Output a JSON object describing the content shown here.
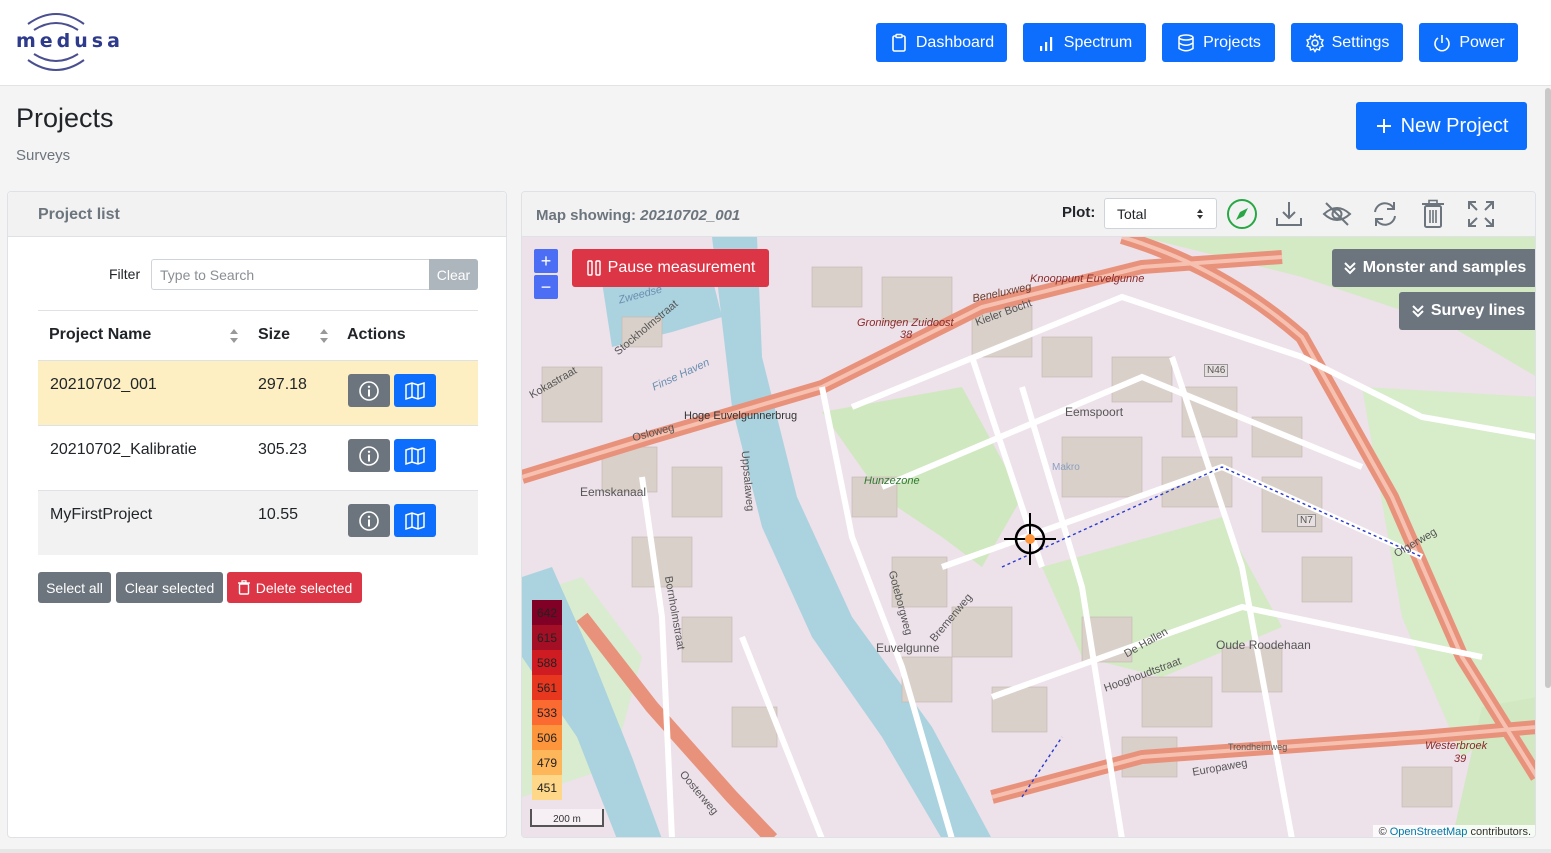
{
  "app": {
    "logo_text": "medusa"
  },
  "nav": {
    "dashboard": "Dashboard",
    "spectrum": "Spectrum",
    "projects": "Projects",
    "settings": "Settings",
    "power": "Power"
  },
  "page": {
    "title": "Projects",
    "subtitle": "Surveys",
    "new_project": "New Project"
  },
  "project_list": {
    "title": "Project list",
    "filter_label": "Filter",
    "filter_placeholder": "Type to Search",
    "filter_clear": "Clear",
    "columns": {
      "name": "Project Name",
      "size": "Size",
      "actions": "Actions"
    },
    "rows": [
      {
        "name": "20210702_001",
        "size": "297.18",
        "selected": true
      },
      {
        "name": "20210702_Kalibratie",
        "size": "305.23",
        "selected": false
      },
      {
        "name": "MyFirstProject",
        "size": "10.55",
        "selected": false
      }
    ],
    "select_all": "Select all",
    "clear_selected": "Clear selected",
    "delete_selected": "Delete selected"
  },
  "map": {
    "showing_label": "Map showing:",
    "showing_value": "20210702_001",
    "plot_label": "Plot:",
    "plot_value": "Total",
    "pause": "Pause measurement",
    "monster": "Monster and samples",
    "survey_lines": "Survey lines",
    "zoom_in": "+",
    "zoom_out": "−",
    "scale": "200 m",
    "attribution_prefix": "©",
    "attribution_link": "OpenStreetMap",
    "attribution_suffix": "contributors.",
    "legend": [
      {
        "value": "642",
        "color": "#800026"
      },
      {
        "value": "615",
        "color": "#a50f26"
      },
      {
        "value": "588",
        "color": "#cf1c23"
      },
      {
        "value": "561",
        "color": "#e7371f"
      },
      {
        "value": "533",
        "color": "#fa6a31"
      },
      {
        "value": "506",
        "color": "#fd953c"
      },
      {
        "value": "479",
        "color": "#feb65a"
      },
      {
        "value": "451",
        "color": "#fed888"
      }
    ],
    "labels": [
      "Beneluxweg",
      "Knooppunt Euvelgunne",
      "Groningen Zuidoost",
      "38",
      "Kieler Bocht",
      "N46",
      "Eemspoort",
      "Hoge Euvelgunnerbrug",
      "Osloweg",
      "Eemskanaal",
      "Hunzezone",
      "Euvelgunne",
      "Oude Roodehaan",
      "Oosterweg",
      "Europaweg",
      "Westerbroek",
      "39",
      "Trondheimweg",
      "Hooghoudtstraat",
      "Bornholmstraat",
      "Uppsalaweg",
      "N7",
      "Olgerweg",
      "Stockholmstraat",
      "Finse Haven",
      "Zweedse",
      "Kokastraat",
      "Makro",
      "Goteborgweg",
      "Bremenweg",
      "De Hallen"
    ]
  }
}
